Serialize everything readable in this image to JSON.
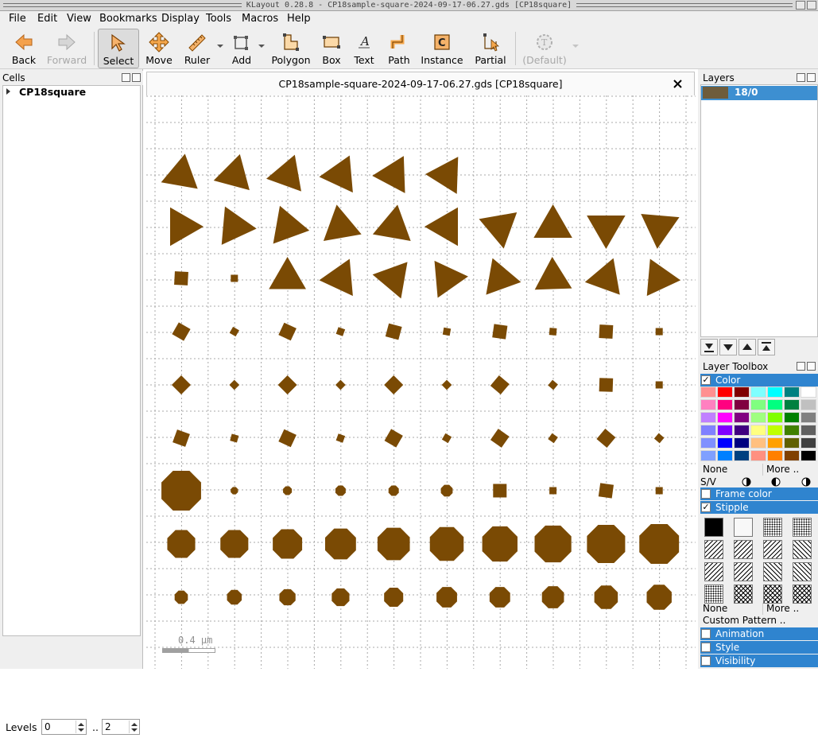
{
  "window": {
    "title": "KLayout 0.28.8 - CP18sample-square-2024-09-17-06.27.gds [CP18square]"
  },
  "menu": [
    "File",
    "Edit",
    "View",
    "Bookmarks",
    "Display",
    "Tools",
    "Macros",
    "Help"
  ],
  "toolbar": {
    "back": "Back",
    "forward": "Forward",
    "select": "Select",
    "move": "Move",
    "ruler": "Ruler",
    "add": "Add",
    "polygon": "Polygon",
    "box": "Box",
    "text": "Text",
    "path": "Path",
    "instance": "Instance",
    "partial": "Partial",
    "default": "(Default)"
  },
  "cells_panel": {
    "title": "Cells",
    "top_cell": "CP18square"
  },
  "levels": {
    "label": "Levels",
    "from": "0",
    "sep": "..",
    "to": "2"
  },
  "view": {
    "tab_title": "CP18sample-square-2024-09-17-06.27.gds [CP18square]",
    "scale_label": "0.4 µm",
    "shape_color": "#7a4a04"
  },
  "layers_panel": {
    "title": "Layers",
    "layer_name": "18/0",
    "layer_color": "#6e5c3c"
  },
  "toolbox": {
    "title": "Layer Toolbox",
    "color_section": "Color",
    "palette": [
      [
        "#ff9090",
        "#ff0000",
        "#800000",
        "#80ffff",
        "#00ffff",
        "#008080",
        "#ffffff"
      ],
      [
        "#ff80c0",
        "#ff0080",
        "#800040",
        "#80ff80",
        "#00ff80",
        "#008040",
        "#c0c0c0"
      ],
      [
        "#c080ff",
        "#ff00ff",
        "#800080",
        "#a0ff80",
        "#80ff00",
        "#008000",
        "#808080"
      ],
      [
        "#8080ff",
        "#8000ff",
        "#400080",
        "#ffff80",
        "#c0ff00",
        "#408000",
        "#606060"
      ],
      [
        "#8090ff",
        "#0000ff",
        "#000080",
        "#ffc080",
        "#ffa000",
        "#606000",
        "#404040"
      ],
      [
        "#80a0ff",
        "#0080ff",
        "#004080",
        "#ff9080",
        "#ff8000",
        "#804000",
        "#000000"
      ]
    ],
    "none": "None",
    "more": "More ..",
    "sv": "S/V",
    "frame_color": "Frame color",
    "stipple": "Stipple",
    "custom_pattern": "Custom Pattern ..",
    "animation": "Animation",
    "style": "Style",
    "visibility": "Visibility"
  }
}
